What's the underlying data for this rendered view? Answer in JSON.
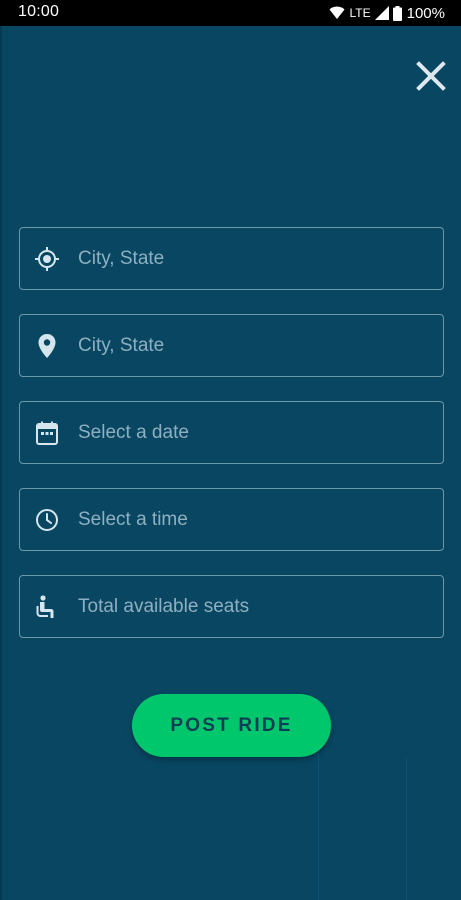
{
  "status_bar": {
    "time": "10:00",
    "network": "LTE",
    "battery": "100%"
  },
  "colors": {
    "background": "#084662",
    "field_border": "#6c98ad",
    "placeholder": "#8fb0c1",
    "icon": "#d6e6ee",
    "accent": "#00c76b",
    "button_text": "#0b3e55"
  },
  "form": {
    "fields": [
      {
        "placeholder": "City, State",
        "icon": "my-location-icon"
      },
      {
        "placeholder": "City, State",
        "icon": "location-pin-icon"
      },
      {
        "placeholder": "Select a date",
        "icon": "calendar-icon"
      },
      {
        "placeholder": "Select a time",
        "icon": "clock-icon"
      },
      {
        "placeholder": "Total available seats",
        "icon": "seat-icon"
      }
    ],
    "submit_label": "POST RIDE"
  }
}
